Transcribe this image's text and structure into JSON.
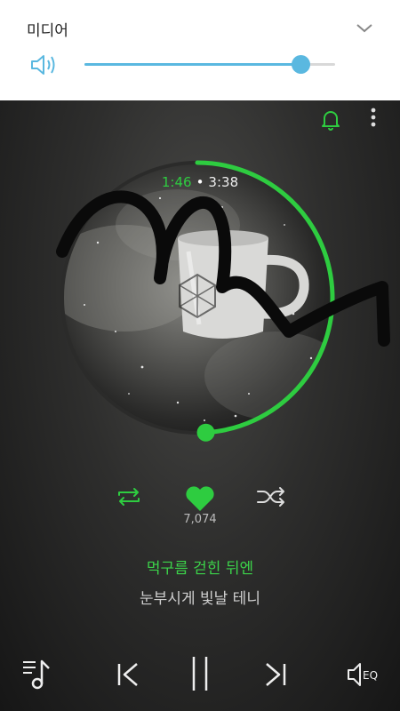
{
  "volume_panel": {
    "title": "미디어",
    "level": 0.86,
    "accent": "#5ab8e0",
    "icons": [
      "speaker-icon",
      "chevron-down-icon"
    ]
  },
  "player": {
    "accent": "#2ecc40",
    "elapsed": "1:46",
    "total": "3:38",
    "progress": 0.49,
    "like_count": "7,074",
    "lyric_current": "먹구름 걷힌 뒤엔",
    "lyric_next": "눈부시게 빛날 테니",
    "eq_label": "EQ",
    "icons": [
      "bell-icon",
      "more-vert-icon",
      "repeat-icon",
      "heart-icon",
      "shuffle-icon",
      "playlist-icon",
      "previous-icon",
      "pause-icon",
      "next-icon",
      "eq-icon"
    ]
  }
}
